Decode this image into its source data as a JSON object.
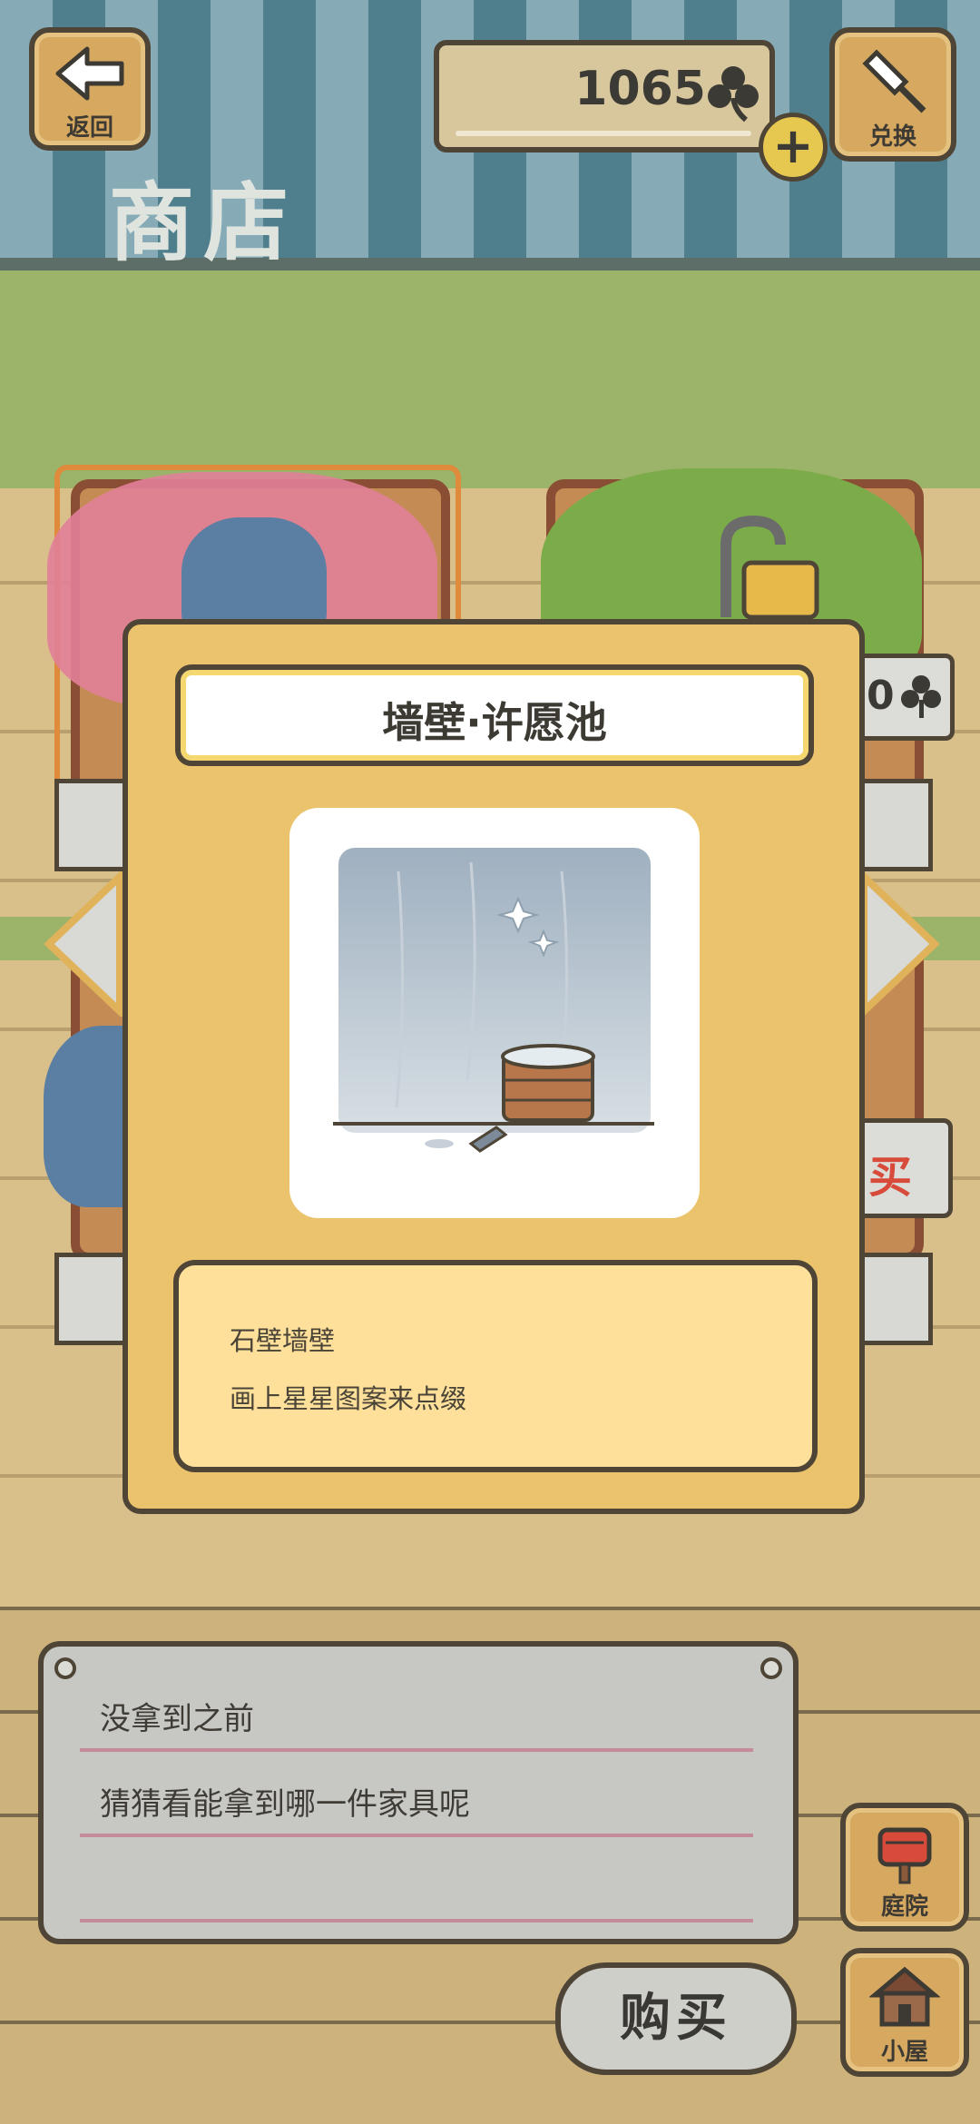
{
  "header": {
    "back_label": "返回",
    "exchange_label": "兑换",
    "clover_count": "1065",
    "plus": "+",
    "shop_title": "商店"
  },
  "background": {
    "partial_price": "0",
    "partial_buy": "买"
  },
  "modal": {
    "title": "墙壁·许愿池",
    "description": [
      "石壁墙壁",
      "画上星星图案来点缀"
    ]
  },
  "notice": {
    "lines": [
      "没拿到之前",
      "猜猜看能拿到哪一件家具呢"
    ]
  },
  "actions": {
    "buy_label": "购买",
    "yard_label": "庭院",
    "cabin_label": "小屋"
  },
  "colors": {
    "modal_bg": "#ecc36d",
    "desc_bg": "#fee09a",
    "awning_light": "#86abb7",
    "awning_dark": "#4f7f8c",
    "wood": "#d6a860",
    "outline": "#4e4536"
  },
  "icons": {
    "back": "arrow-left-icon",
    "exchange": "bell-icon",
    "clover": "clover-icon",
    "yard": "mailbox-icon",
    "cabin": "house-icon"
  }
}
